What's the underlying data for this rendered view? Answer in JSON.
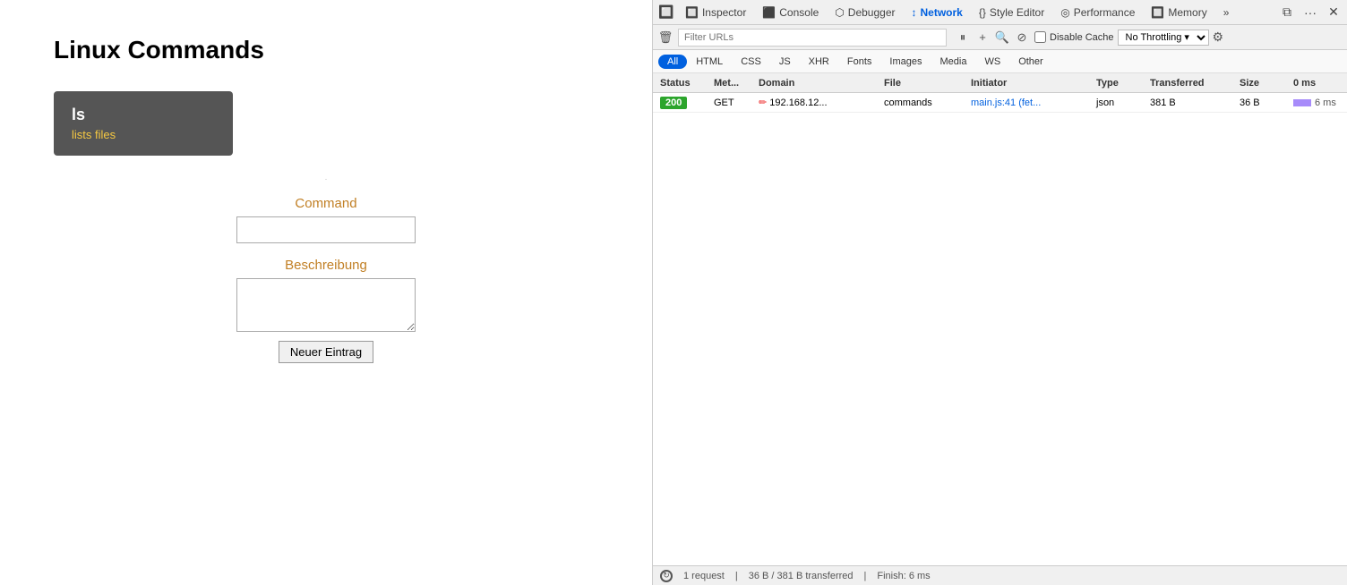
{
  "app": {
    "title": "Linux Commands",
    "command_card": {
      "name": "ls",
      "description": "lists files"
    },
    "dot": ".",
    "form": {
      "command_label": "Command",
      "command_placeholder": "",
      "description_label": "Beschreibung",
      "description_placeholder": "",
      "submit_label": "Neuer Eintrag"
    }
  },
  "devtools": {
    "tabs": [
      {
        "id": "inspector",
        "label": "Inspector",
        "icon": "🔲"
      },
      {
        "id": "console",
        "label": "Console",
        "icon": "⬛"
      },
      {
        "id": "debugger",
        "label": "Debugger",
        "icon": "⬡"
      },
      {
        "id": "network",
        "label": "Network",
        "icon": "↕",
        "active": true
      },
      {
        "id": "style-editor",
        "label": "Style Editor",
        "icon": "{}"
      },
      {
        "id": "performance",
        "label": "Performance",
        "icon": "◎"
      },
      {
        "id": "memory",
        "label": "Memory",
        "icon": "🔲"
      },
      {
        "id": "more",
        "label": "»",
        "icon": ""
      }
    ],
    "toolbar2": {
      "filter_placeholder": "Filter URLs",
      "disable_cache_label": "Disable Cache",
      "throttle_label": "No Throttling ▾"
    },
    "filter_tabs": [
      {
        "id": "all",
        "label": "All",
        "active": true
      },
      {
        "id": "html",
        "label": "HTML"
      },
      {
        "id": "css",
        "label": "CSS"
      },
      {
        "id": "js",
        "label": "JS"
      },
      {
        "id": "xhr",
        "label": "XHR"
      },
      {
        "id": "fonts",
        "label": "Fonts"
      },
      {
        "id": "images",
        "label": "Images"
      },
      {
        "id": "media",
        "label": "Media"
      },
      {
        "id": "ws",
        "label": "WS"
      },
      {
        "id": "other",
        "label": "Other"
      }
    ],
    "table": {
      "headers": [
        "Status",
        "Met...",
        "Domain",
        "File",
        "Initiator",
        "Type",
        "Transferred",
        "Size",
        "0 ms"
      ],
      "rows": [
        {
          "status": "200",
          "method": "GET",
          "domain": "192.168.12...",
          "file": "commands",
          "initiator": "main.js:41 (fet...",
          "type": "json",
          "transferred": "381 B",
          "size": "36 B",
          "timing": "6 ms"
        }
      ]
    },
    "statusbar": {
      "requests": "1 request",
      "transferred": "36 B / 381 B transferred",
      "finish": "Finish: 6 ms"
    }
  }
}
